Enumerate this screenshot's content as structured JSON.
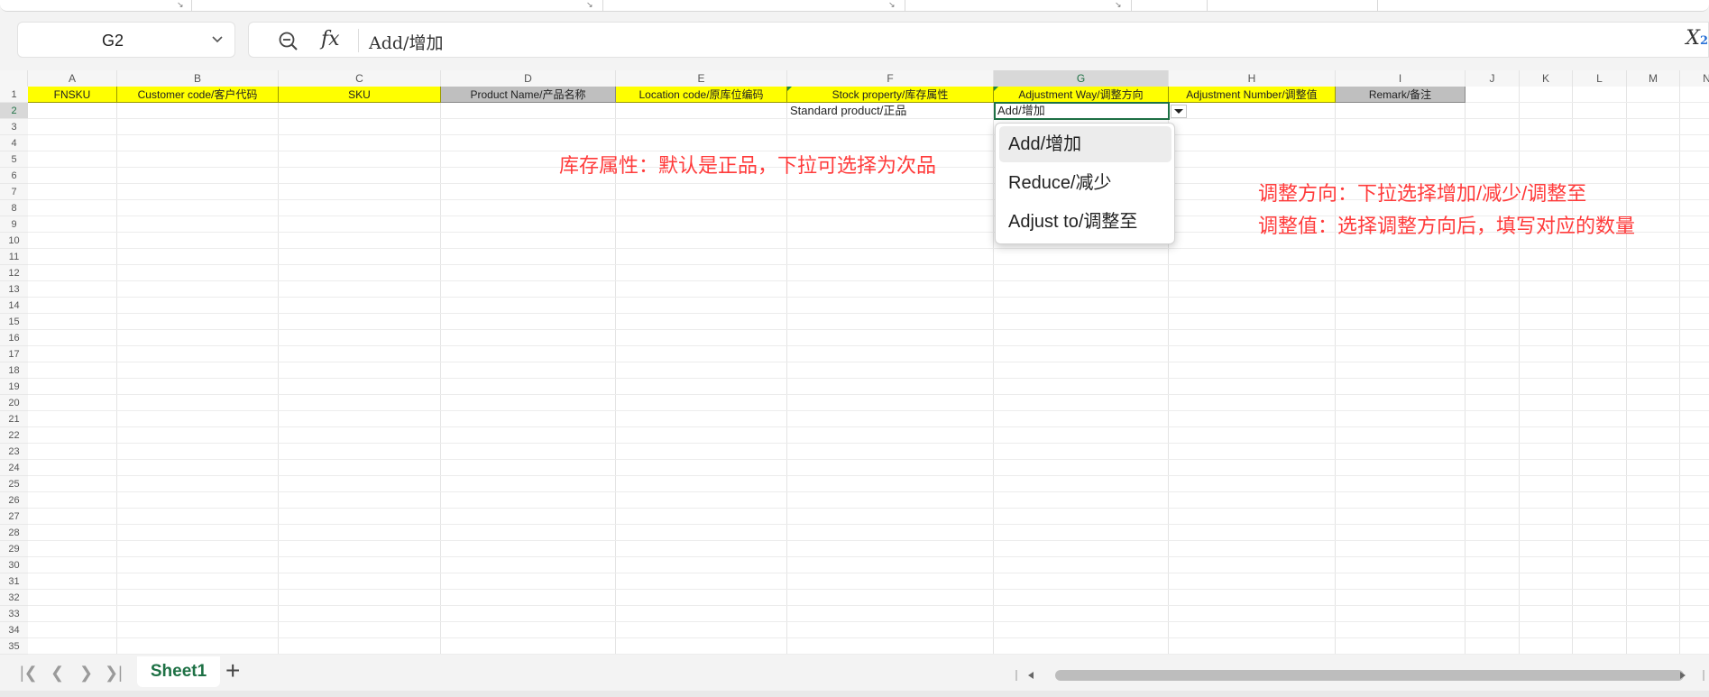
{
  "name_box": {
    "cell_ref": "G2"
  },
  "formula_bar": {
    "fx_label": "fx",
    "content": "Add/增加",
    "x_label": "X",
    "x_sub": "2"
  },
  "columns": [
    "A",
    "B",
    "C",
    "D",
    "E",
    "F",
    "G",
    "H",
    "I",
    "J",
    "K",
    "L",
    "M",
    "N"
  ],
  "rows": [
    "1",
    "2",
    "3",
    "4",
    "5",
    "6",
    "7",
    "8",
    "9",
    "10",
    "11",
    "12",
    "13",
    "14",
    "15",
    "16",
    "17",
    "18",
    "19",
    "20",
    "21",
    "22",
    "23",
    "24",
    "25",
    "26",
    "27",
    "28",
    "29",
    "30",
    "31",
    "32",
    "33",
    "34",
    "35"
  ],
  "header_row": [
    {
      "col": "A",
      "text": "FNSKU",
      "fill": "yellow"
    },
    {
      "col": "B",
      "text": "Customer code/客户代码",
      "fill": "yellow"
    },
    {
      "col": "C",
      "text": "SKU",
      "fill": "yellow"
    },
    {
      "col": "D",
      "text": "Product Name/产品名称",
      "fill": "gray"
    },
    {
      "col": "E",
      "text": "Location code/原库位编码",
      "fill": "yellow"
    },
    {
      "col": "F",
      "text": "Stock property/库存属性",
      "fill": "yellow"
    },
    {
      "col": "G",
      "text": "Adjustment Way/调整方向",
      "fill": "yellow"
    },
    {
      "col": "H",
      "text": "Adjustment Number/调整值",
      "fill": "yellow"
    },
    {
      "col": "I",
      "text": "Remark/备注",
      "fill": "gray"
    }
  ],
  "row2": {
    "F": "Standard product/正品",
    "G": "Add/增加"
  },
  "dropdown": {
    "options": [
      "Add/增加",
      "Reduce/减少",
      "Adjust to/调整至"
    ],
    "highlighted": "Add/增加"
  },
  "annotations": {
    "stock_note": "库存属性：默认是正品，下拉可选择为次品",
    "adjust_note_line1": "调整方向：下拉选择增加/减少/调整至",
    "adjust_note_line2": "调整值：选择调整方向后，填写对应的数量"
  },
  "sheet_tabs": {
    "active": "Sheet1",
    "add_label": "+"
  },
  "colors": {
    "accent": "#1e7145",
    "header_yellow": "#ffff00",
    "header_gray": "#bfbfbf",
    "note_red": "#ff3b3b"
  }
}
